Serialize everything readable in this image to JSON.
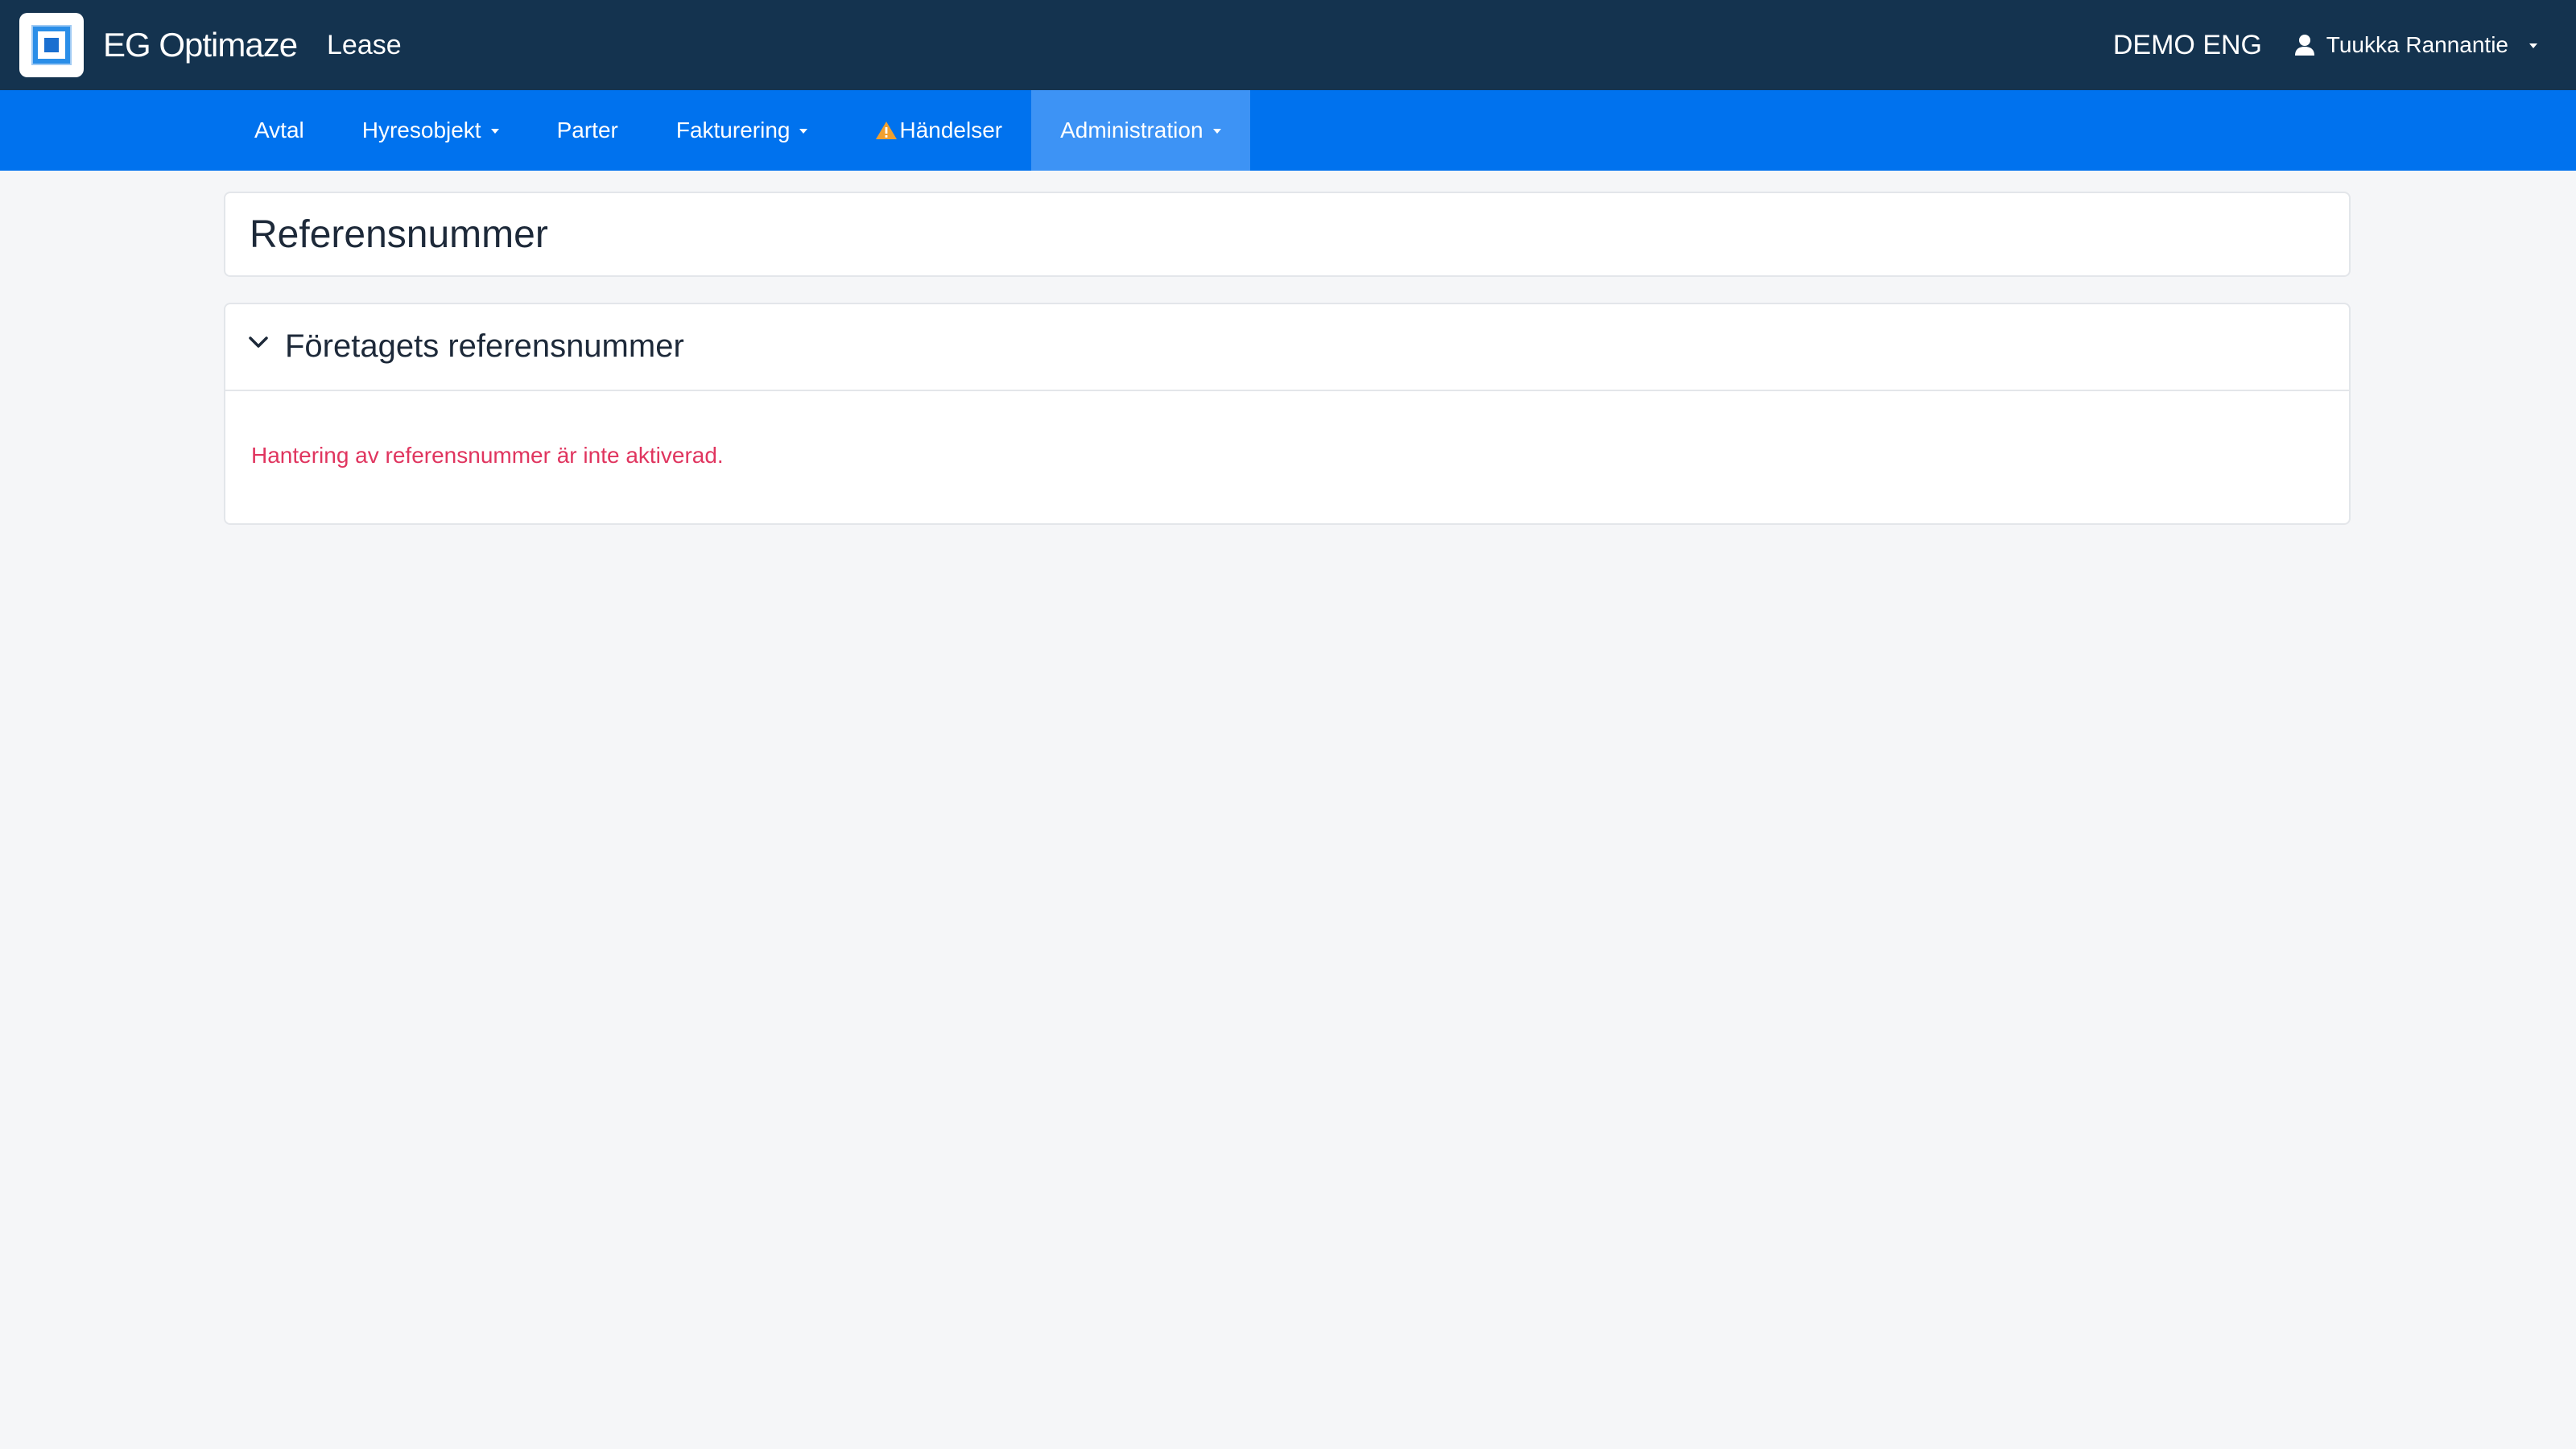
{
  "header": {
    "brand": "EG Optimaze",
    "product": "Lease",
    "company": "DEMO ENG",
    "user_name": "Tuukka Rannantie"
  },
  "nav": {
    "items": [
      {
        "label": "Avtal",
        "dropdown": false
      },
      {
        "label": "Hyresobjekt",
        "dropdown": true
      },
      {
        "label": "Parter",
        "dropdown": false
      },
      {
        "label": "Fakturering",
        "dropdown": true
      },
      {
        "label": "Händelser",
        "dropdown": false,
        "warning": true
      },
      {
        "label": "Administration",
        "dropdown": true,
        "active": true
      }
    ]
  },
  "page": {
    "title": "Referensnummer"
  },
  "section": {
    "title": "Företagets referensnummer",
    "expanded": true,
    "message": "Hantering av referensnummer är inte aktiverad."
  },
  "colors": {
    "topbar": "#14334f",
    "navbar": "#0072ee",
    "nav_active": "#3d93f5",
    "warning": "#f0a030",
    "error_text": "#e0355f",
    "background": "#f5f6f8"
  }
}
